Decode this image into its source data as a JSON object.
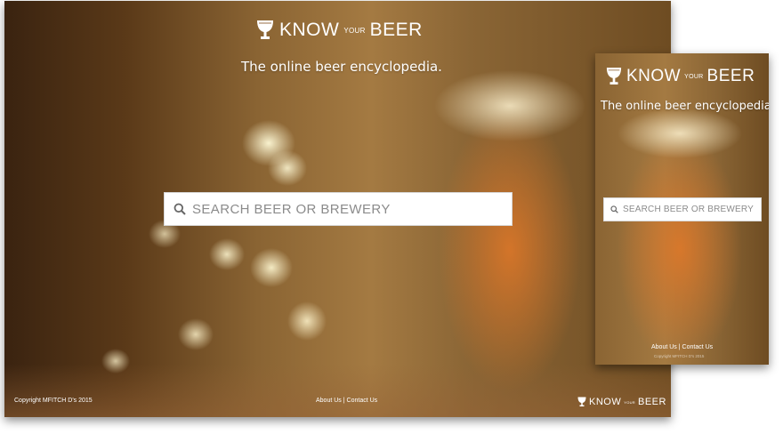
{
  "brand": {
    "know": "KNOW",
    "your": "YOUR",
    "beer": "BEER"
  },
  "tagline": "The online beer encyclopedia.",
  "search": {
    "placeholder": "SEARCH BEER OR BREWERY",
    "icon": "search-icon"
  },
  "footer": {
    "copyright": "Copyright MFITCH D's 2015",
    "about": "About Us",
    "separator": "|",
    "contact": "Contact Us"
  },
  "colors": {
    "text": "#ffffff",
    "search_bg": "#ffffff",
    "placeholder": "#8b8b8b"
  }
}
